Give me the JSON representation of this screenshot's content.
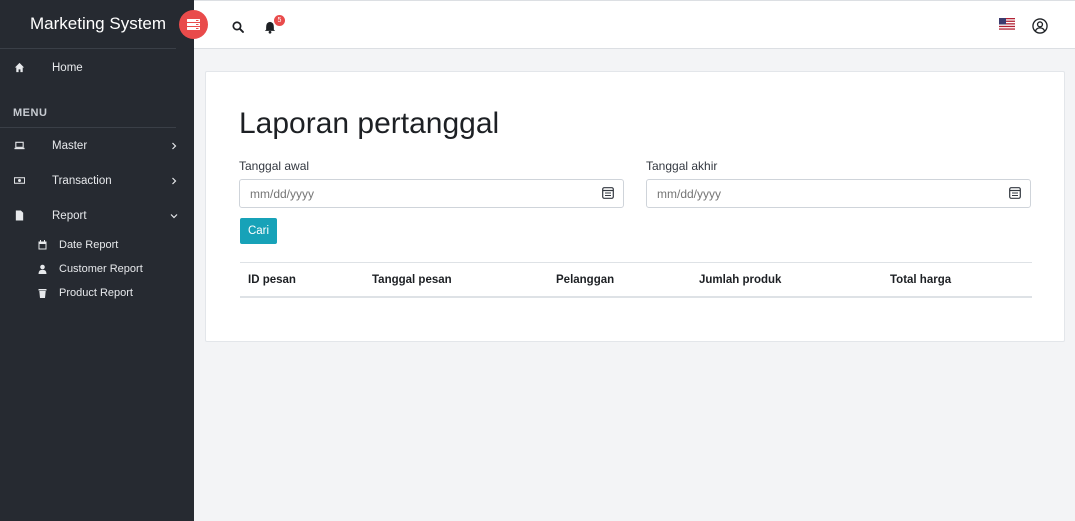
{
  "sidebar": {
    "brand": "Marketing System",
    "home": "Home",
    "menu_header": "MENU",
    "items": [
      {
        "label": "Master"
      },
      {
        "label": "Transaction"
      },
      {
        "label": "Report"
      }
    ],
    "report_sub": [
      {
        "label": "Date Report",
        "icon": "calendar-icon"
      },
      {
        "label": "Customer Report",
        "icon": "user-icon"
      },
      {
        "label": "Product Report",
        "icon": "trash-icon"
      }
    ]
  },
  "topbar": {
    "notification_count": "5",
    "language": "en-US"
  },
  "main": {
    "title": "Laporan pertanggal",
    "start_label": "Tanggal awal",
    "end_label": "Tanggal akhir",
    "date_placeholder": "mm/dd/yyyy",
    "search_button": "Cari",
    "columns": [
      "ID pesan",
      "Tanggal pesan",
      "Pelanggan",
      "Jumlah produk",
      "Total harga"
    ]
  },
  "colors": {
    "sidebar_bg": "#262a31",
    "accent_red": "#e94b4b",
    "button_teal": "#17a2b8"
  }
}
